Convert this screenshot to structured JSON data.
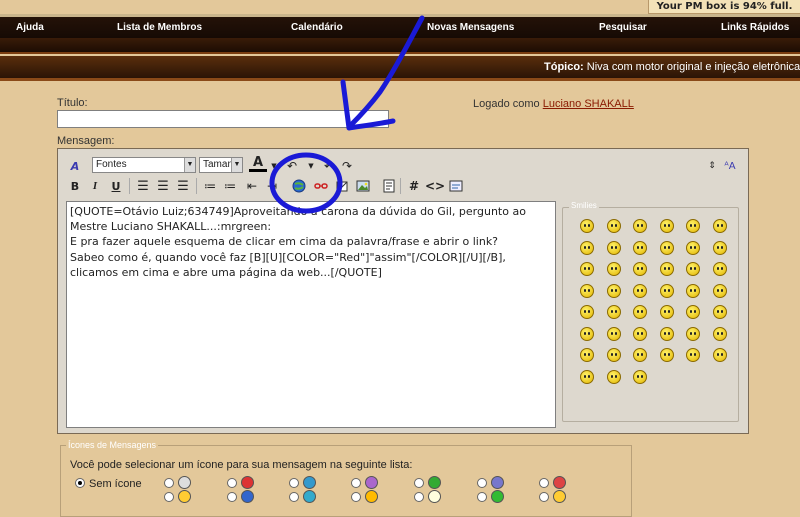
{
  "pm_notice": "Your PM box is 94% full.",
  "nav": {
    "items": [
      "Ajuda",
      "Lista de Membros",
      "Calendário",
      "Novas Mensagens",
      "Pesquisar",
      "Links Rápidos"
    ]
  },
  "topic": {
    "label": "Tópico:",
    "value": "Niva com motor original e injeção eletrônica"
  },
  "form": {
    "title_label": "Título:",
    "title_value": "",
    "logged_prefix": "Logado como",
    "logged_user": "Luciano SHAKALL",
    "message_label": "Mensagem:"
  },
  "toolbar": {
    "font_select": "Fontes",
    "size_select": "Taman"
  },
  "message": {
    "lines": [
      "[QUOTE=Otávio Luiz;634749]Aproveitando a carona da dúvida do Gil, pergunto ao",
      "Mestre Luciano SHAKALL...:mrgreen:",
      "E pra fazer aquele esquema de clicar em cima da palavra/frase e abrir o link?",
      "Sabeo como é, quando você faz [B][U][COLOR=\"Red\"]\"assim\"[/COLOR][/U][/B],",
      "clicamos em cima e abre uma página da web...[/QUOTE]"
    ]
  },
  "smilies": {
    "legend": "Smilies",
    "count": 45
  },
  "icons": {
    "legend": "Ícones de Mensagens",
    "description": "Você pode selecionar um ícone para sua mensagem na seguinte lista:",
    "no_icon_label": "Sem ícone"
  },
  "colors": {
    "annotation": "#1a1ad6",
    "link": "#8a1a00",
    "nav_bg": "#1e0e05",
    "page_bg": "#e3c89a"
  }
}
